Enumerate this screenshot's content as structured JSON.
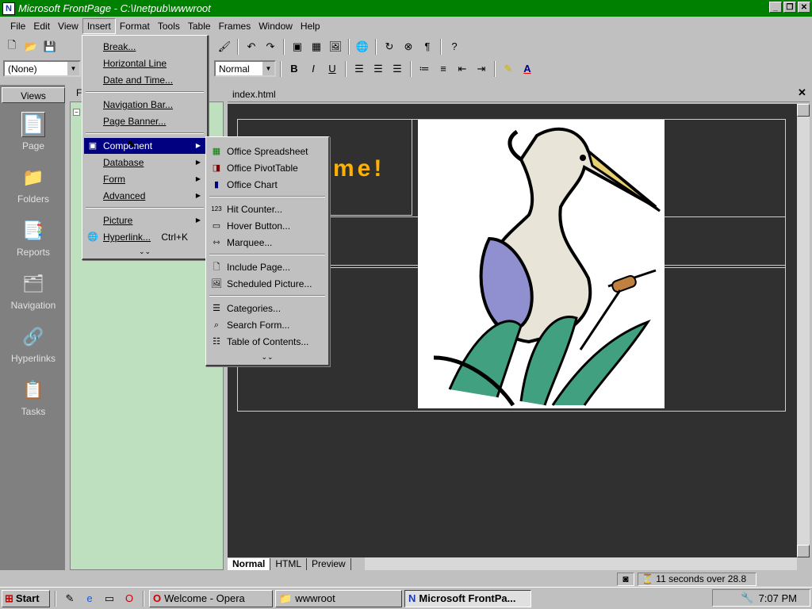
{
  "window": {
    "title": "Microsoft FrontPage - C:\\Inetpub\\wwwroot"
  },
  "menubar": {
    "items": [
      "File",
      "Edit",
      "View",
      "Insert",
      "Format",
      "Tools",
      "Table",
      "Frames",
      "Window",
      "Help"
    ],
    "active": "Insert"
  },
  "format_toolbar": {
    "style_value": "(None)",
    "font_size_value": "Normal"
  },
  "views_bar": {
    "title": "Views",
    "items": [
      {
        "label": "Page",
        "icon": "page-view-icon",
        "selected": true
      },
      {
        "label": "Folders",
        "icon": "folder-icon"
      },
      {
        "label": "Reports",
        "icon": "reports-icon"
      },
      {
        "label": "Navigation",
        "icon": "navigation-icon"
      },
      {
        "label": "Hyperlinks",
        "icon": "hyperlinks-icon"
      },
      {
        "label": "Tasks",
        "icon": "tasks-icon"
      }
    ]
  },
  "folder_pane": {
    "header": "F"
  },
  "editor": {
    "file_tab": "index.html",
    "welcome_text": "me!",
    "image": "heron-clipart"
  },
  "insert_menu": {
    "items": [
      {
        "label": "Break..."
      },
      {
        "label": "Horizontal Line"
      },
      {
        "label": "Date and Time..."
      },
      {
        "label": "Navigation Bar..."
      },
      {
        "label": "Page Banner..."
      },
      {
        "label": "Component",
        "submenu": true,
        "highlighted": true
      },
      {
        "label": "Database",
        "submenu": true
      },
      {
        "label": "Form",
        "submenu": true
      },
      {
        "label": "Advanced",
        "submenu": true
      },
      {
        "label": "Picture",
        "submenu": true
      },
      {
        "label": "Hyperlink...",
        "shortcut": "Ctrl+K"
      }
    ]
  },
  "component_submenu": {
    "items": [
      {
        "label": "Office Spreadsheet"
      },
      {
        "label": "Office PivotTable"
      },
      {
        "label": "Office Chart"
      },
      {
        "label": "Hit Counter..."
      },
      {
        "label": "Hover Button..."
      },
      {
        "label": "Marquee..."
      },
      {
        "label": "Include Page..."
      },
      {
        "label": "Scheduled Picture..."
      },
      {
        "label": "Categories..."
      },
      {
        "label": "Search Form..."
      },
      {
        "label": "Table of Contents..."
      }
    ]
  },
  "view_tabs": {
    "items": [
      "Normal",
      "HTML",
      "Preview"
    ],
    "active": "Normal"
  },
  "status_bar": {
    "download_time": "11 seconds over 28.8"
  },
  "taskbar": {
    "start_label": "Start",
    "buttons": [
      {
        "label": "Welcome - Opera",
        "icon": "opera-icon"
      },
      {
        "label": "wwwroot",
        "icon": "folder-icon"
      },
      {
        "label": "Microsoft FrontPa...",
        "icon": "frontpage-icon",
        "pressed": true
      }
    ],
    "clock": "7:07 PM"
  },
  "colors": {
    "title_bar": "#008000",
    "menu_highlight": "#000080",
    "welcome_text": "#ffb000",
    "canvas": "#303030",
    "folder_pane": "#bfe0bf"
  }
}
